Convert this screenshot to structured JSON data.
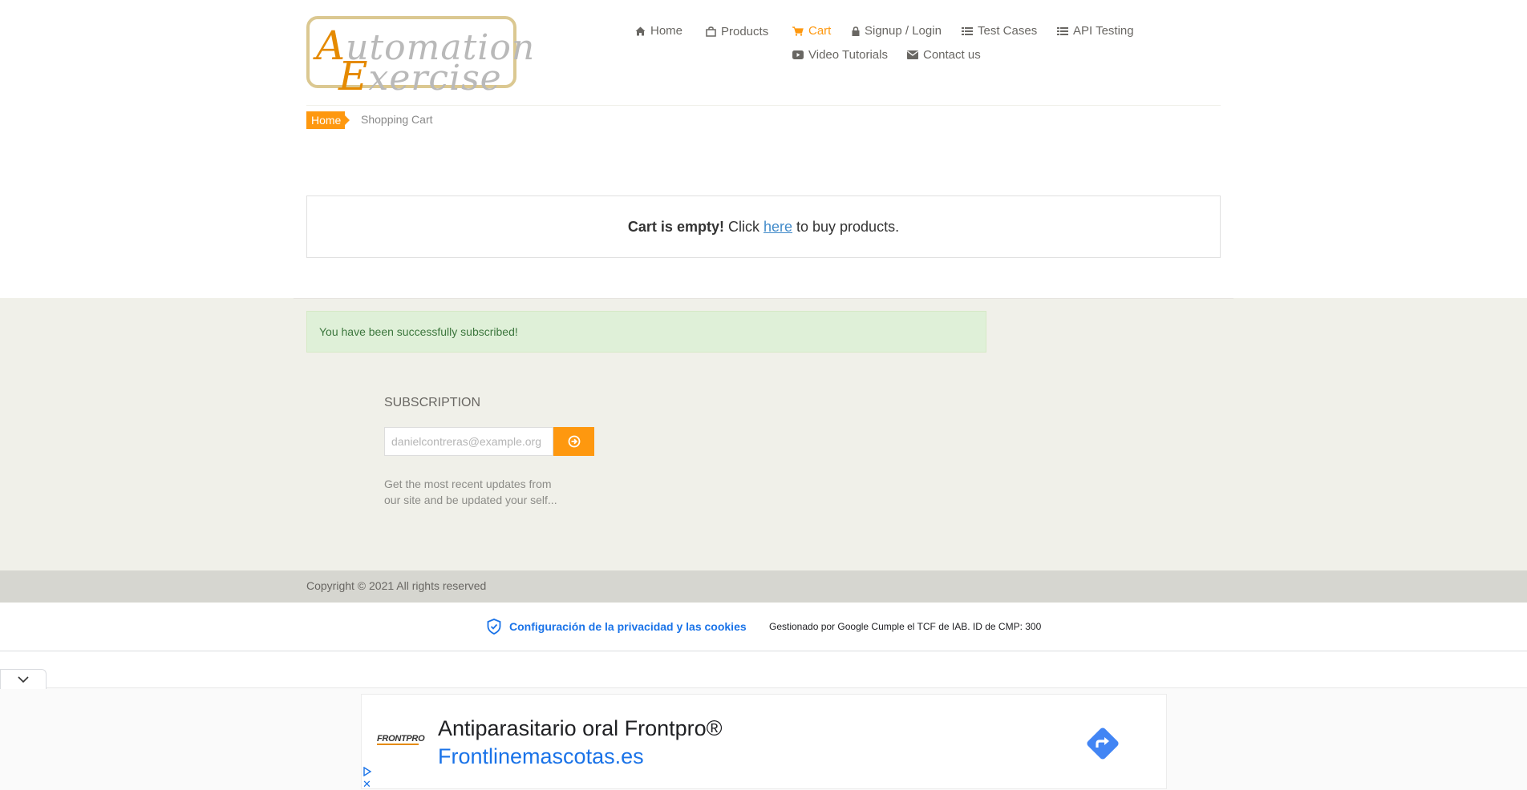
{
  "logo": {
    "line1_cap": "A",
    "line1_rest": "utomation",
    "line2_cap": "E",
    "line2_rest": "xercise"
  },
  "nav": {
    "home": "Home",
    "products": "Products",
    "cart": "Cart",
    "signup": "Signup / Login",
    "test_cases": "Test Cases",
    "api_testing": "API Testing",
    "video_tutorials": "Video Tutorials",
    "contact_us": "Contact us",
    "active": "Cart",
    "accent_color": "#fe980f"
  },
  "breadcrumb": {
    "home": "Home",
    "current": "Shopping Cart"
  },
  "cart": {
    "empty_bold": "Cart is empty!",
    "click_text": "Click",
    "link_text": "here",
    "after_text": "to buy products."
  },
  "footer": {
    "success_message": "You have been successfully subscribed!",
    "subscription_title": "SUBSCRIPTION",
    "email_placeholder": "danielcontreras@example.org",
    "description": "Get the most recent updates from our site and be updated your self...",
    "copyright": "Copyright © 2021 All rights reserved"
  },
  "privacy": {
    "link_text": "Configuración de la privacidad y las cookies",
    "note": "Gestionado por Google Cumple el TCF de IAB. ID de CMP: 300"
  },
  "ad": {
    "brand": "FRONTPRO",
    "title": "Antiparasitario oral Frontpro®",
    "domain": "Frontlinemascotas.es",
    "close_glyph": "✕"
  }
}
